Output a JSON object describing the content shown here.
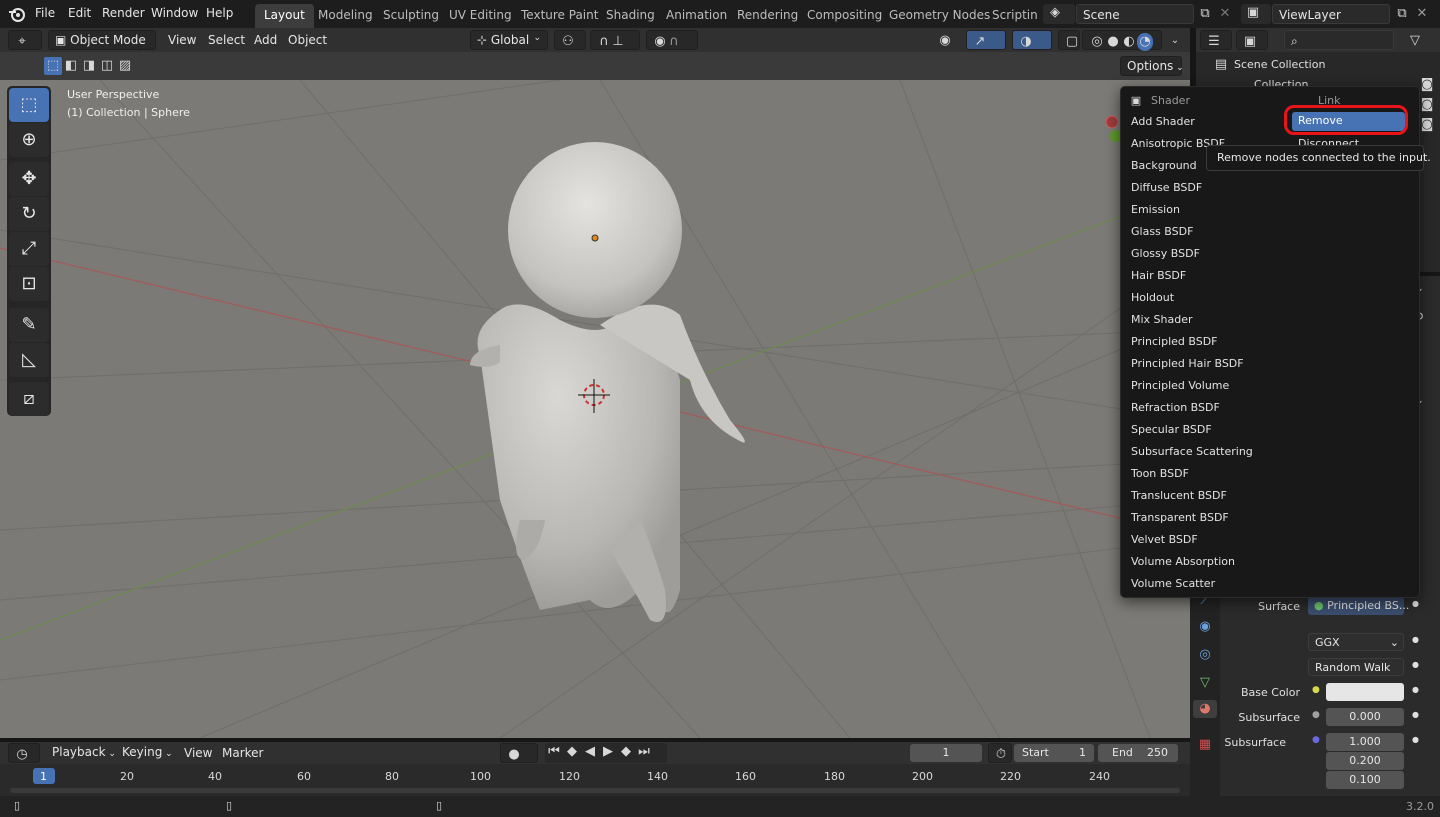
{
  "topbar": {
    "menus": [
      "File",
      "Edit",
      "Render",
      "Window",
      "Help"
    ],
    "workspaces": [
      "Layout",
      "Modeling",
      "Sculpting",
      "UV Editing",
      "Texture Paint",
      "Shading",
      "Animation",
      "Rendering",
      "Compositing",
      "Geometry Nodes",
      "Scripting"
    ],
    "active_workspace": "Layout",
    "scene": "Scene",
    "view_layer": "ViewLayer"
  },
  "viewport_header": {
    "mode": "Object Mode",
    "menus": [
      "View",
      "Select",
      "Add",
      "Object"
    ],
    "transform_orientation": "Global",
    "options_label": "Options"
  },
  "viewport": {
    "perspective_label": "User Perspective",
    "collection_label": "(1) Collection | Sphere"
  },
  "shader_menu": {
    "header_left": "Shader",
    "header_right": "Link",
    "items": [
      "Add Shader",
      "Anisotropic BSDF",
      "Background",
      "Diffuse BSDF",
      "Emission",
      "Glass BSDF",
      "Glossy BSDF",
      "Hair BSDF",
      "Holdout",
      "Mix Shader",
      "Principled BSDF",
      "Principled Hair BSDF",
      "Principled Volume",
      "Refraction BSDF",
      "Specular BSDF",
      "Subsurface Scattering",
      "Toon BSDF",
      "Translucent BSDF",
      "Transparent BSDF",
      "Velvet BSDF",
      "Volume Absorption",
      "Volume Scatter"
    ],
    "link_items": [
      "Remove",
      "Disconnect"
    ],
    "highlight_color": "#4772b3",
    "annotation_color": "#e8141a"
  },
  "tooltip": {
    "text": "Remove nodes connected to the input."
  },
  "outliner": {
    "scene_collection": "Scene Collection",
    "collection": "Collection"
  },
  "properties": {
    "surface_label": "Surface",
    "surface_value": "Principled BS...",
    "distribution": "GGX",
    "subsurface_method": "Random Walk",
    "base_color_label": "Base Color",
    "subsurface_label": "Subsurface",
    "subsurface_value": "0.000",
    "subsurface_radius_label": "Subsurface",
    "radius_values": [
      "1.000",
      "0.200",
      "0.100"
    ]
  },
  "timeline": {
    "menus": [
      "Playback",
      "Keying",
      "View",
      "Marker"
    ],
    "current_frame": "1",
    "start_label": "Start",
    "start_value": "1",
    "end_label": "End",
    "end_value": "250",
    "ticks": [
      "1",
      "20",
      "40",
      "60",
      "80",
      "100",
      "120",
      "140",
      "160",
      "180",
      "200",
      "220",
      "240"
    ]
  },
  "statusbar": {
    "version": "3.2.0"
  }
}
